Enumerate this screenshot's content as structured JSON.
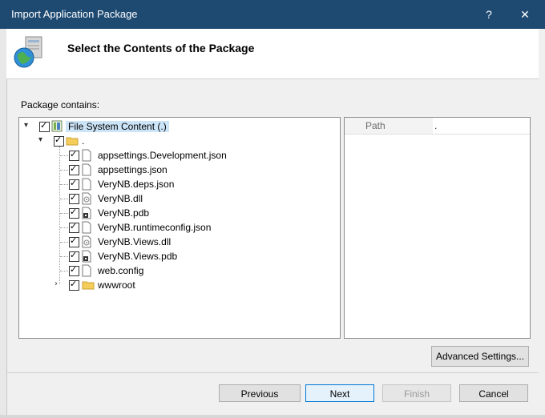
{
  "window": {
    "title": "Import Application Package",
    "help_glyph": "?",
    "close_glyph": "✕"
  },
  "header": {
    "heading": "Select the Contents of the Package"
  },
  "package_contains_label": "Package contains:",
  "tree": {
    "root_label": "File System Content (.)",
    "folder_label": ".",
    "files": [
      "appsettings.Development.json",
      "appsettings.json",
      "VeryNB.deps.json",
      "VeryNB.dll",
      "VeryNB.pdb",
      "VeryNB.runtimeconfig.json",
      "VeryNB.Views.dll",
      "VeryNB.Views.pdb",
      "web.config"
    ],
    "subfolder_label": "wwwroot"
  },
  "path_panel": {
    "header": "Path",
    "value": "."
  },
  "buttons": {
    "advanced": "Advanced Settings...",
    "previous": "Previous",
    "next": "Next",
    "finish": "Finish",
    "cancel": "Cancel"
  },
  "colors": {
    "titlebar": "#1e4a72",
    "primary_border": "#0078d7"
  },
  "icons": [
    "package-icon",
    "help-icon",
    "close-icon",
    "folder-icon",
    "file-icon",
    "dll-icon",
    "pdb-icon",
    "filesystem-icon"
  ]
}
